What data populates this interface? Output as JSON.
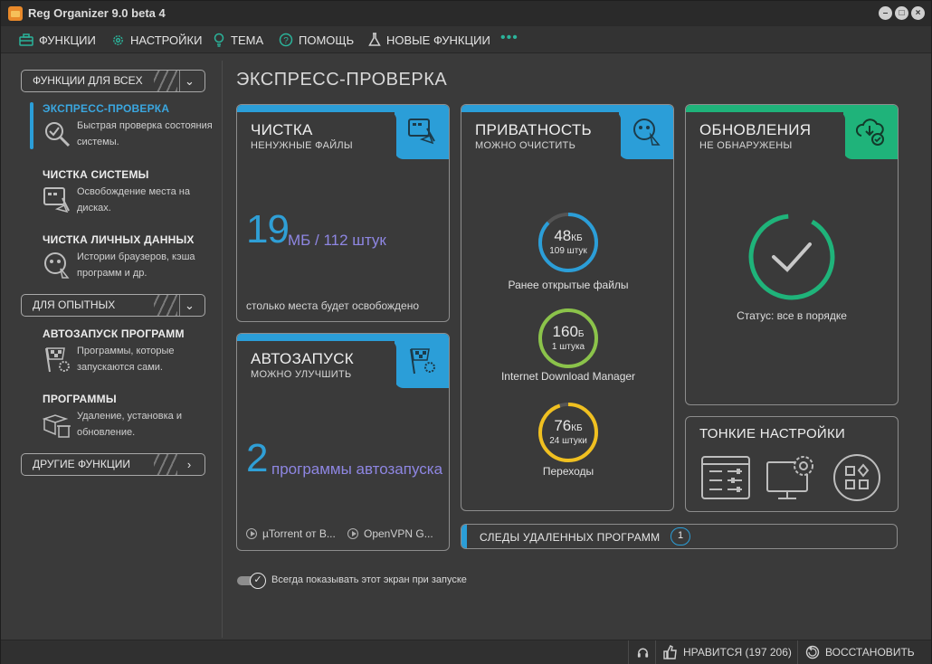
{
  "window": {
    "title": "Reg Organizer 9.0 beta 4",
    "controls": [
      "minimize",
      "maximize",
      "close"
    ]
  },
  "menu": [
    {
      "label": "ФУНКЦИИ",
      "icon": "toolbox-icon"
    },
    {
      "label": "НАСТРОЙКИ",
      "icon": "gear-icon"
    },
    {
      "label": "ТЕМА",
      "icon": "bulb-icon"
    },
    {
      "label": "ПОМОЩЬ",
      "icon": "help-icon"
    },
    {
      "label": "НОВЫЕ ФУНКЦИИ",
      "icon": "flask-icon"
    }
  ],
  "menu_more": "•••",
  "sidebar": {
    "group_all": "ФУНКЦИИ ДЛЯ ВСЕХ",
    "group_expert": "ДЛЯ ОПЫТНЫХ",
    "group_other": "ДРУГИЕ ФУНКЦИИ",
    "items": [
      {
        "name": "ЭКСПРЕСС-ПРОВЕРКА",
        "desc": "Быстрая проверка состояния системы.",
        "icon": "magnifier-check-icon",
        "active": true
      },
      {
        "name": "ЧИСТКА СИСТЕМЫ",
        "desc": "Освобождение места на дисках.",
        "icon": "broom-screen-icon"
      },
      {
        "name": "ЧИСТКА ЛИЧНЫХ ДАННЫХ",
        "desc": "Истории браузеров, кэша программ и др.",
        "icon": "privacy-broom-icon"
      },
      {
        "name": "АВТОЗАПУСК ПРОГРАММ",
        "desc": "Программы, которые запускаются сами.",
        "icon": "race-flag-icon"
      },
      {
        "name": "ПРОГРАММЫ",
        "desc": "Удаление, установка и обновление.",
        "icon": "box-trash-icon"
      }
    ]
  },
  "main": {
    "title": "ЭКСПРЕСС-ПРОВЕРКА",
    "cleanup": {
      "title": "ЧИСТКА",
      "subtitle": "НЕНУЖНЫЕ ФАЙЛЫ",
      "big": "19",
      "rest": "МБ / 112 штук",
      "note": "столько места будет освобождено",
      "accent": "#2b9ed8"
    },
    "startup": {
      "title": "АВТОЗАПУСК",
      "subtitle": "МОЖНО УЛУЧШИТЬ",
      "big": "2",
      "rest": "программы автозапуска",
      "apps": [
        "µTorrent от B...",
        "OpenVPN G..."
      ],
      "accent": "#2b9ed8"
    },
    "privacy": {
      "title": "ПРИВАТНОСТЬ",
      "subtitle": "МОЖНО ОЧИСТИТЬ",
      "accent": "#2b9ed8",
      "rings": [
        {
          "value": "48",
          "unit": "КБ",
          "count": "109 штук",
          "label": "Ранее открытые файлы",
          "color": "#2b9ed8"
        },
        {
          "value": "160",
          "unit": "Б",
          "count": "1 штука",
          "label": "Internet Download Manager",
          "color": "#8bc34a"
        },
        {
          "value": "76",
          "unit": "КБ",
          "count": "24 штуки",
          "label": "Переходы",
          "color": "#f0c020"
        }
      ]
    },
    "updates": {
      "title": "ОБНОВЛЕНИЯ",
      "subtitle": "НЕ ОБНАРУЖЕНЫ",
      "status": "Статус: все в порядке",
      "accent": "#1fb37a"
    },
    "tweaks": {
      "title": "ТОНКИЕ НАСТРОЙКИ",
      "icons": [
        "sliders-panel-icon",
        "monitor-gear-icon",
        "apps-grid-icon"
      ]
    },
    "leftovers": {
      "label": "СЛЕДЫ УДАЛЕННЫХ ПРОГРАММ",
      "count": "1"
    },
    "show_on_start": "Всегда показывать этот экран при запуске"
  },
  "statusbar": {
    "like": "НРАВИТСЯ (197 206)",
    "restore": "ВОССТАНОВИТЬ"
  }
}
